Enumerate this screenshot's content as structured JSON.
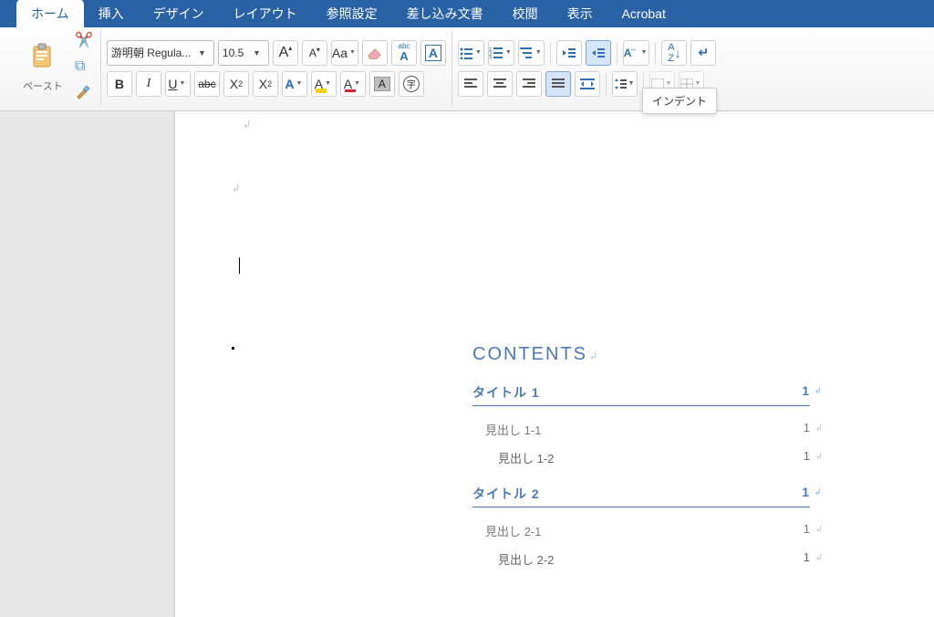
{
  "menu": {
    "tabs": [
      "ホーム",
      "挿入",
      "デザイン",
      "レイアウト",
      "参照設定",
      "差し込み文書",
      "校閲",
      "表示",
      "Acrobat"
    ],
    "active": 0
  },
  "ribbon": {
    "paste_label": "ペースト",
    "font_name": "游明朝 Regula...",
    "font_size": "10.5",
    "inc_font": "A",
    "dec_font": "A",
    "change_case": "Aa",
    "clear_fmt_icon": "eraser",
    "phonetic": "abc",
    "char_border": "A",
    "bold": "B",
    "italic": "I",
    "underline": "U",
    "strike": "abc",
    "subscript": "X2",
    "superscript": "X2",
    "text_effect": "A",
    "highlight": "A",
    "font_color": "A",
    "char_shade": "A",
    "enclosed": "字",
    "bullets_icon": "bullets",
    "numbering_icon": "numbering",
    "multilevel_icon": "multilevel",
    "outdent_icon": "outdent",
    "indent_icon": "indent",
    "sort_icon": "sort",
    "show_marks_icon": "pilcrow",
    "align_left": "align-left",
    "align_center": "align-center",
    "align_right": "align-right",
    "align_justify": "align-justify",
    "line_spacing": "line-spacing",
    "indent_tooltip": "インデント"
  },
  "document": {
    "toc_heading": "CONTENTS",
    "entries": [
      {
        "level": 1,
        "label": "タイトル 1",
        "page": "1"
      },
      {
        "level": 2,
        "label": "見出し 1-1",
        "page": "1"
      },
      {
        "level": 3,
        "label": "見出し 1-2",
        "page": "1"
      },
      {
        "level": 1,
        "label": "タイトル 2",
        "page": "1"
      },
      {
        "level": 2,
        "label": "見出し 2-1",
        "page": "1"
      },
      {
        "level": 3,
        "label": "見出し 2-2",
        "page": "1"
      }
    ]
  }
}
